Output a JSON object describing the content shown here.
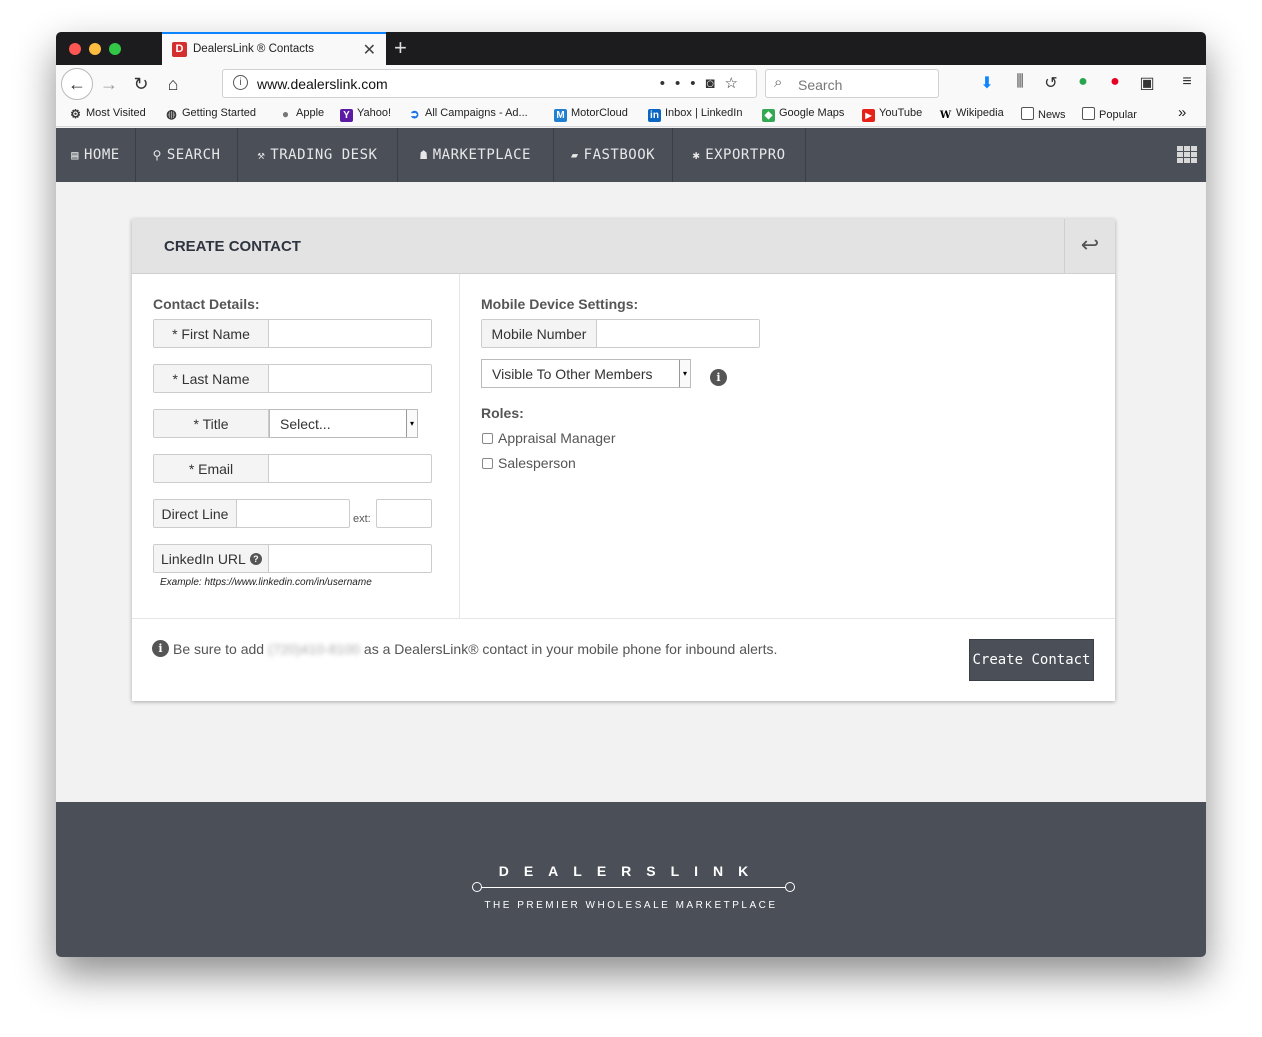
{
  "browser": {
    "tab_title": "DealersLink ® Contacts",
    "favicon_letter": "D",
    "url": "www.dealerslink.com",
    "search_placeholder": "Search"
  },
  "bookmarks": [
    {
      "label": "Most Visited",
      "icon": "gear-icon"
    },
    {
      "label": "Getting Started",
      "icon": "globe-icon"
    },
    {
      "label": "Apple",
      "icon": "apple-icon"
    },
    {
      "label": "Yahoo!",
      "icon": "yahoo-icon"
    },
    {
      "label": "All Campaigns - Ad...",
      "icon": "campaign-icon"
    },
    {
      "label": "MotorCloud",
      "icon": "motorcloud-icon"
    },
    {
      "label": "Inbox | LinkedIn",
      "icon": "linkedin-icon"
    },
    {
      "label": "Google Maps",
      "icon": "maps-icon"
    },
    {
      "label": "YouTube",
      "icon": "youtube-icon"
    },
    {
      "label": "Wikipedia",
      "icon": "wikipedia-icon"
    },
    {
      "label": "News",
      "icon": "folder-icon"
    },
    {
      "label": "Popular",
      "icon": "folder-icon"
    }
  ],
  "nav": {
    "home": "HOME",
    "search": "SEARCH",
    "trading_desk": "TRADING DESK",
    "marketplace": "MARKETPLACE",
    "fastbook": "FASTBOOK",
    "exportpro": "EXPORTPRO"
  },
  "form": {
    "title": "CREATE CONTACT",
    "contact_details_label": "Contact Details:",
    "first_name_label": "* First Name",
    "last_name_label": "* Last Name",
    "title_label": "* Title",
    "title_select": "Select...",
    "email_label": "* Email",
    "direct_line_label": "Direct Line",
    "ext_label": "ext:",
    "linkedin_label": "LinkedIn URL",
    "linkedin_example": "Example: https://www.linkedin.com/in/username",
    "mobile_settings_label": "Mobile Device Settings:",
    "mobile_number_label": "Mobile Number",
    "visibility_select": "Visible To Other Members",
    "roles_label": "Roles:",
    "roles": [
      "Appraisal Manager",
      "Salesperson"
    ],
    "notice_prefix": "Be sure to add",
    "notice_phone": "(720)410-8100",
    "notice_suffix": "as a DealersLink® contact in your mobile phone for inbound alerts.",
    "create_button": "Create Contact"
  },
  "footer": {
    "brand": "DEALERSLINK",
    "tagline": "THE PREMIER WHOLESALE MARKETPLACE"
  },
  "colors": {
    "nav_bg": "#4a4f58",
    "tab_accent": "#0a84ff",
    "button_bg": "#4a4f58"
  }
}
